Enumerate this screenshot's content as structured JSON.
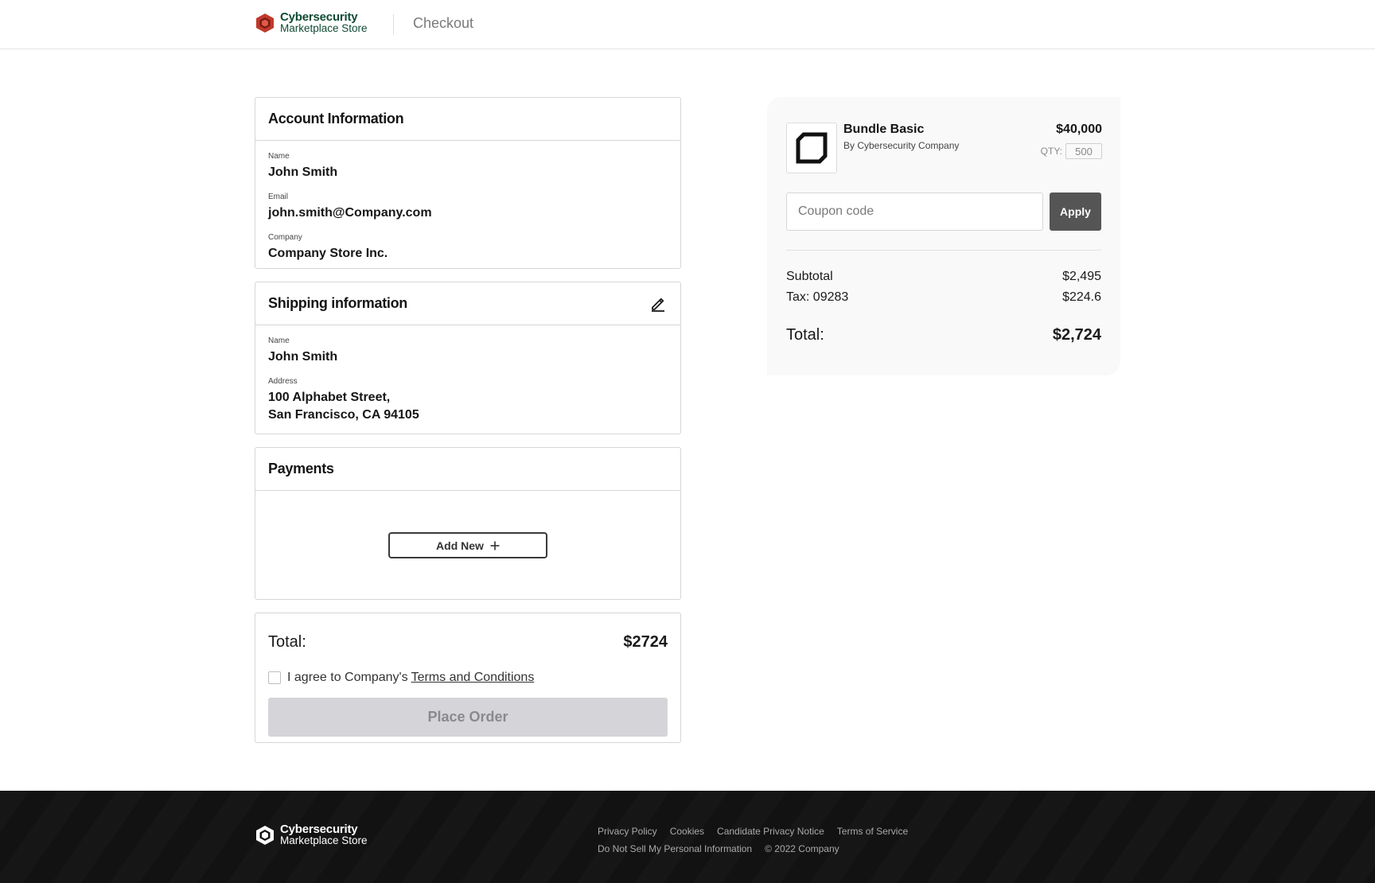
{
  "header": {
    "brand_line1": "Cybersecurity",
    "brand_line2": "Marketplace Store",
    "page_title": "Checkout",
    "brand_color": "#0f4a33",
    "logo_color": "#c0392b"
  },
  "account": {
    "title": "Account Information",
    "name_label": "Name",
    "name": "John Smith",
    "email_label": "Email",
    "email": "john.smith@Company.com",
    "company_label": "Company",
    "company": "Company Store Inc."
  },
  "shipping": {
    "title": "Shipping information",
    "edit_icon": "pencil-icon",
    "name_label": "Name",
    "name": "John Smith",
    "address_label": "Address",
    "address_line1": "100 Alphabet Street,",
    "address_line2": "San Francisco, CA 94105"
  },
  "payments": {
    "title": "Payments",
    "add_new_label": "Add New"
  },
  "checkout": {
    "total_label": "Total:",
    "total_value": "$2724",
    "agree_text": "I agree to Company's",
    "terms_link": "Terms and Conditions",
    "place_order_label": "Place Order"
  },
  "summary": {
    "product_name": "Bundle Basic",
    "product_vendor": "By Cybersecurity Company",
    "product_price": "$40,000",
    "qty_label": "QTY:",
    "qty_value": "500",
    "coupon_placeholder": "Coupon code",
    "apply_label": "Apply",
    "subtotal_label": "Subtotal",
    "subtotal_value": "$2,495",
    "tax_label": "Tax: 09283",
    "tax_value": "$224.6",
    "total_label": "Total:",
    "total_value": "$2,724"
  },
  "footer": {
    "brand_line1": "Cybersecurity",
    "brand_line2": "Marketplace Store",
    "links": [
      "Privacy Policy",
      "Cookies",
      "Candidate Privacy Notice",
      "Terms of Service",
      "Do Not Sell My Personal Information"
    ],
    "copyright": "© 2022 Company"
  }
}
